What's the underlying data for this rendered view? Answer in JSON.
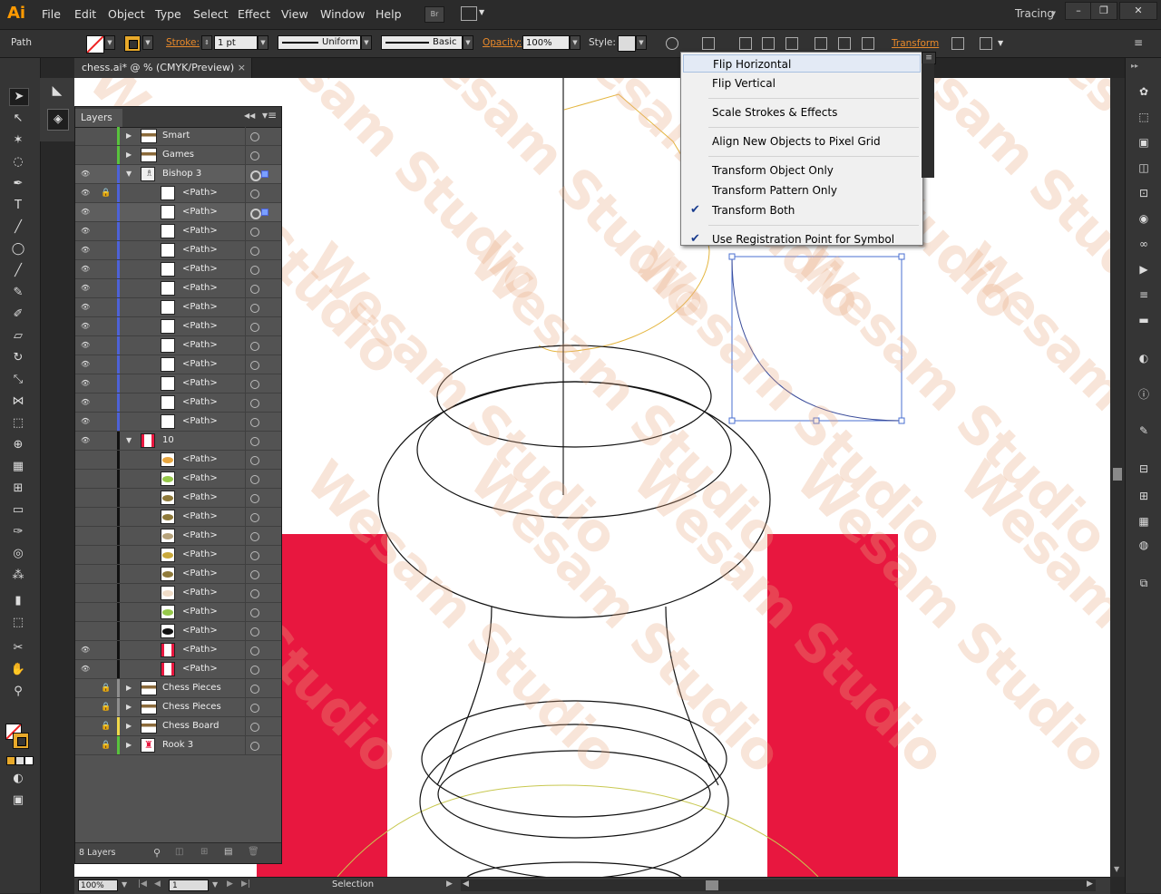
{
  "app": {
    "logo": "Ai",
    "menus": [
      "File",
      "Edit",
      "Object",
      "Type",
      "Select",
      "Effect",
      "View",
      "Window",
      "Help"
    ],
    "bridge_label": "Br",
    "workspace": "Tracing"
  },
  "control_bar": {
    "selection_type": "Path",
    "stroke_label": "Stroke:",
    "stroke_weight": "1 pt",
    "profile_uniform": "Uniform",
    "brush_basic": "Basic",
    "opacity_label": "Opacity:",
    "opacity_value": "100%",
    "style_label": "Style:",
    "transform_label": "Transform"
  },
  "document_tab": {
    "title": "chess.ai* @ % (CMYK/Preview)",
    "close": "×"
  },
  "layers_panel": {
    "title": "Layers",
    "count": "8 Layers",
    "rows": [
      {
        "name": "Smart",
        "indent": 0,
        "eye": false,
        "lock": false,
        "tri": "▶",
        "color": "#58c23d",
        "thumb": "wide"
      },
      {
        "name": "Games",
        "indent": 0,
        "eye": false,
        "lock": false,
        "tri": "▶",
        "color": "#58c23d",
        "thumb": "wide"
      },
      {
        "name": "Bishop 3",
        "indent": 0,
        "eye": true,
        "lock": false,
        "tri": "▼",
        "color": "#4d62d8",
        "thumb": "figure",
        "selected": true
      },
      {
        "name": "<Path>",
        "indent": 1,
        "eye": true,
        "lock": true,
        "color": "#4d62d8"
      },
      {
        "name": "<Path>",
        "indent": 1,
        "eye": true,
        "lock": false,
        "color": "#4d62d8",
        "selected": true
      },
      {
        "name": "<Path>",
        "indent": 1,
        "eye": true,
        "lock": false,
        "color": "#4d62d8"
      },
      {
        "name": "<Path>",
        "indent": 1,
        "eye": true,
        "lock": false,
        "color": "#4d62d8"
      },
      {
        "name": "<Path>",
        "indent": 1,
        "eye": true,
        "lock": false,
        "color": "#4d62d8"
      },
      {
        "name": "<Path>",
        "indent": 1,
        "eye": true,
        "lock": false,
        "color": "#4d62d8"
      },
      {
        "name": "<Path>",
        "indent": 1,
        "eye": true,
        "lock": false,
        "color": "#4d62d8"
      },
      {
        "name": "<Path>",
        "indent": 1,
        "eye": true,
        "lock": false,
        "color": "#4d62d8"
      },
      {
        "name": "<Path>",
        "indent": 1,
        "eye": true,
        "lock": false,
        "color": "#4d62d8"
      },
      {
        "name": "<Path>",
        "indent": 1,
        "eye": true,
        "lock": false,
        "color": "#4d62d8"
      },
      {
        "name": "<Path>",
        "indent": 1,
        "eye": true,
        "lock": false,
        "color": "#4d62d8"
      },
      {
        "name": "<Path>",
        "indent": 1,
        "eye": true,
        "lock": false,
        "color": "#4d62d8"
      },
      {
        "name": "<Path>",
        "indent": 1,
        "eye": true,
        "lock": false,
        "color": "#4d62d8"
      },
      {
        "name": "10",
        "indent": 0,
        "eye": true,
        "lock": false,
        "tri": "▼",
        "color": "#111111",
        "thumb": "flag"
      },
      {
        "name": "<Path>",
        "indent": 1,
        "eye": false,
        "lock": false,
        "color": "#111111",
        "thumb": "orange"
      },
      {
        "name": "<Path>",
        "indent": 1,
        "eye": false,
        "lock": false,
        "color": "#111111",
        "thumb": "green"
      },
      {
        "name": "<Path>",
        "indent": 1,
        "eye": false,
        "lock": false,
        "color": "#111111",
        "thumb": "olive"
      },
      {
        "name": "<Path>",
        "indent": 1,
        "eye": false,
        "lock": false,
        "color": "#111111",
        "thumb": "olive"
      },
      {
        "name": "<Path>",
        "indent": 1,
        "eye": false,
        "lock": false,
        "color": "#111111",
        "thumb": "tan"
      },
      {
        "name": "<Path>",
        "indent": 1,
        "eye": false,
        "lock": false,
        "color": "#111111",
        "thumb": "yellow"
      },
      {
        "name": "<Path>",
        "indent": 1,
        "eye": false,
        "lock": false,
        "color": "#111111",
        "thumb": "olive"
      },
      {
        "name": "<Path>",
        "indent": 1,
        "eye": false,
        "lock": false,
        "color": "#111111",
        "thumb": "skin"
      },
      {
        "name": "<Path>",
        "indent": 1,
        "eye": false,
        "lock": false,
        "color": "#111111",
        "thumb": "green"
      },
      {
        "name": "<Path>",
        "indent": 1,
        "eye": false,
        "lock": false,
        "color": "#111111",
        "thumb": "black"
      },
      {
        "name": "<Path>",
        "indent": 1,
        "eye": true,
        "lock": false,
        "color": "#111111",
        "thumb": "flag"
      },
      {
        "name": "<Path>",
        "indent": 1,
        "eye": true,
        "lock": false,
        "color": "#111111",
        "thumb": "flag"
      },
      {
        "name": "Chess Pieces",
        "indent": 0,
        "eye": false,
        "lock": true,
        "tri": "▶",
        "color": "#8e8e8e",
        "thumb": "wide"
      },
      {
        "name": "Chess Pieces",
        "indent": 0,
        "eye": false,
        "lock": true,
        "tri": "▶",
        "color": "#8e8e8e",
        "thumb": "wide"
      },
      {
        "name": "Chess Board",
        "indent": 0,
        "eye": false,
        "lock": true,
        "tri": "▶",
        "color": "#f0d94a",
        "thumb": "wide"
      },
      {
        "name": "Rook 3",
        "indent": 0,
        "eye": false,
        "lock": true,
        "tri": "▶",
        "color": "#58c23d",
        "thumb": "rook"
      }
    ]
  },
  "transform_menu": {
    "items": [
      {
        "label": "Flip Horizontal",
        "checked": false,
        "highlight": true
      },
      {
        "label": "Flip Vertical",
        "checked": false
      },
      {
        "label": "Scale Strokes & Effects",
        "checked": false,
        "sep_before": true
      },
      {
        "label": "Align New Objects to Pixel Grid",
        "checked": false,
        "sep_before": true
      },
      {
        "label": "Transform Object Only",
        "checked": false,
        "sep_before": true
      },
      {
        "label": "Transform Pattern Only",
        "checked": false
      },
      {
        "label": "Transform Both",
        "checked": true
      },
      {
        "label": "Use Registration Point for Symbol",
        "checked": true,
        "sep_before": true
      }
    ]
  },
  "status_bar": {
    "zoom": "100%",
    "artboard": "1",
    "tool": "Selection"
  },
  "watermark": "Wesam Studio",
  "colors": {
    "accent_orange": "#e8892a",
    "canvas_red": "#e8173f",
    "selection_blue": "#4a6fd1"
  }
}
